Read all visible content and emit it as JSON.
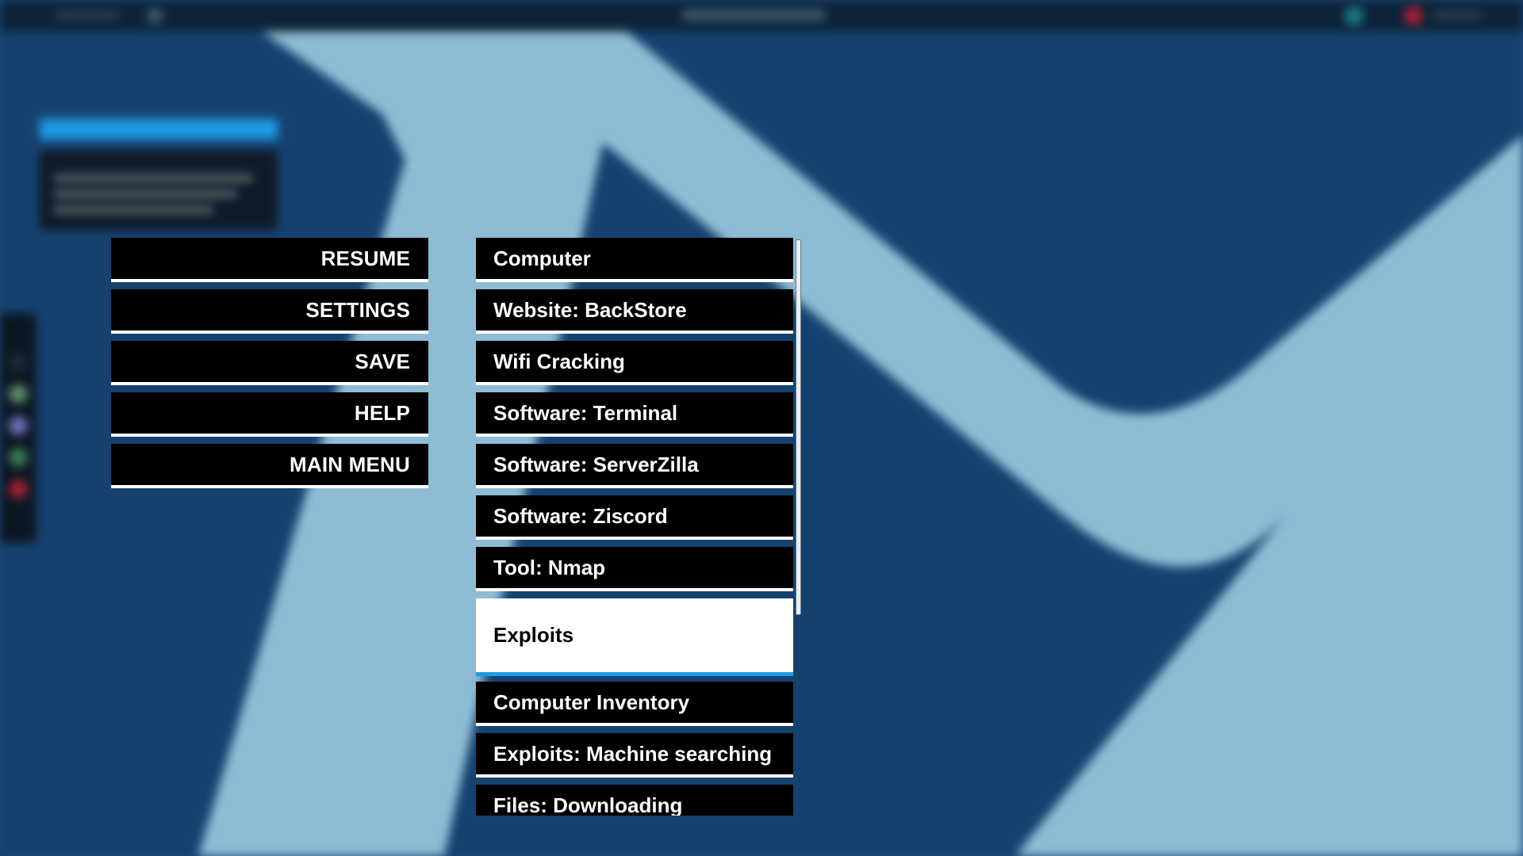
{
  "colors": {
    "button_bg": "#000000",
    "button_text": "#ffffff",
    "selected_bg": "#ffffff",
    "selected_text": "#000000",
    "accent": "#1e9be6",
    "background_dark": "#15416f",
    "background_light": "#8fbcd5"
  },
  "pause_menu": {
    "items": [
      {
        "label": "RESUME"
      },
      {
        "label": "SETTINGS"
      },
      {
        "label": "SAVE"
      },
      {
        "label": "HELP"
      },
      {
        "label": "MAIN MENU"
      }
    ]
  },
  "help_topics": {
    "items": [
      {
        "label": "Computer",
        "selected": false
      },
      {
        "label": "Website: BackStore",
        "selected": false
      },
      {
        "label": "Wifi Cracking",
        "selected": false
      },
      {
        "label": "Software: Terminal",
        "selected": false
      },
      {
        "label": "Software: ServerZilla",
        "selected": false
      },
      {
        "label": "Software: Ziscord",
        "selected": false
      },
      {
        "label": "Tool: Nmap",
        "selected": false
      },
      {
        "label": "Exploits",
        "selected": true
      },
      {
        "label": "Computer Inventory",
        "selected": false
      },
      {
        "label": "Exploits: Machine searching",
        "selected": false
      },
      {
        "label": "Files: Downloading",
        "selected": false
      }
    ]
  }
}
